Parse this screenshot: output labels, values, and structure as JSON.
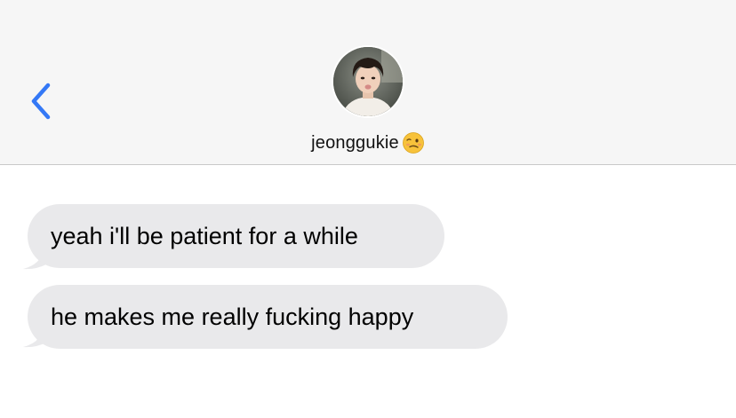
{
  "header": {
    "back_icon": "chevron-left-icon",
    "contact_name": "jeonggukie",
    "contact_emoji": "woozy-face-emoji",
    "accent_color": "#3478f6"
  },
  "messages": [
    {
      "text": "yeah i'll be patient for a while",
      "direction": "received"
    },
    {
      "text": "he makes me really fucking happy",
      "direction": "received"
    }
  ],
  "colors": {
    "header_bg": "#f6f6f6",
    "received_bubble": "#e9e9eb",
    "background": "#ffffff"
  }
}
